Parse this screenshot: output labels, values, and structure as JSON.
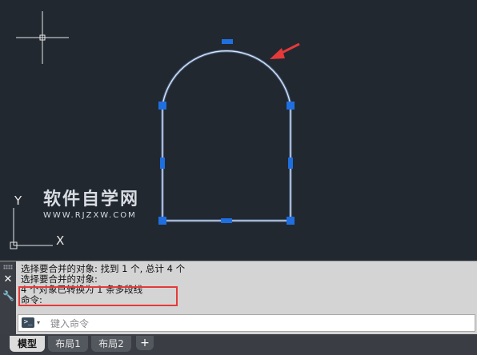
{
  "watermark": {
    "title": "软件自学网",
    "url": "WWW.RJZXW.COM"
  },
  "ucs_icon": {
    "y_label": "Y",
    "x_label": "X"
  },
  "command_panel": {
    "close_glyph": "✕",
    "wrench_glyph": "🔧",
    "history": [
      "选择要合并的对象: 找到 1 个, 总计 4 个",
      "选择要合并的对象:",
      "4 个对象已转换为 1 条多段线",
      "命令:"
    ],
    "prompt_icon": ">_",
    "prompt_caret": "▾",
    "input_placeholder": "键入命令"
  },
  "layout_tabs": {
    "items": [
      {
        "label": "模型",
        "active": true
      },
      {
        "label": "布局1",
        "active": false
      },
      {
        "label": "布局2",
        "active": false
      }
    ],
    "add_label": "+"
  },
  "colors": {
    "canvas_bg": "#212830",
    "polyline": "#b8c9e8",
    "grip": "#1f6fe0",
    "annotation_red": "#e43a3a"
  },
  "icons": {
    "crosshair": "crosshair-cursor-icon",
    "ucs": "ucs-axis-icon",
    "arrow": "red-arrow-icon"
  }
}
